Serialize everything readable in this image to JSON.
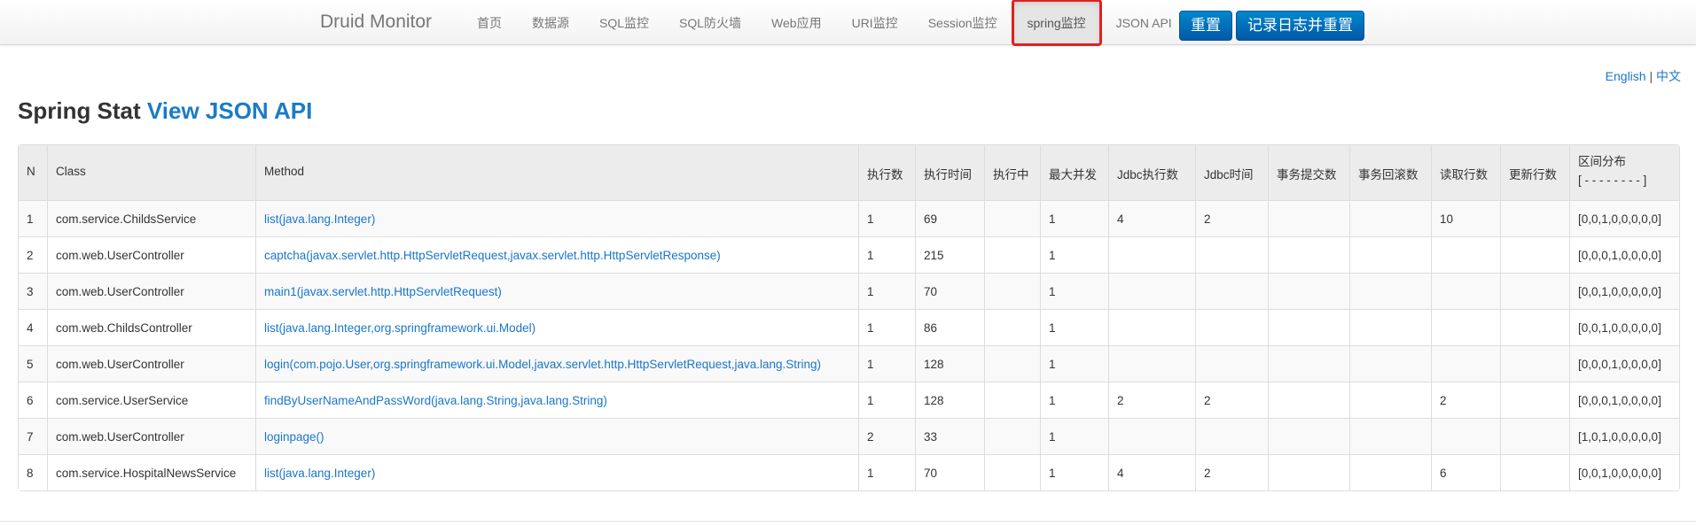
{
  "brand": "Druid Monitor",
  "nav": {
    "items": [
      "首页",
      "数据源",
      "SQL监控",
      "SQL防火墙",
      "Web应用",
      "URI监控",
      "Session监控",
      "spring监控",
      "JSON API"
    ],
    "active_index": 7,
    "reset_label": "重置",
    "log_reset_label": "记录日志并重置"
  },
  "lang": {
    "english": "English",
    "separator": "|",
    "chinese": "中文"
  },
  "title": {
    "text": "Spring Stat",
    "link": "View JSON API"
  },
  "table": {
    "columns": [
      "N",
      "Class",
      "Method",
      "执行数",
      "执行时间",
      "执行中",
      "最大并发",
      "Jdbc执行数",
      "Jdbc时间",
      "事务提交数",
      "事务回滚数",
      "读取行数",
      "更新行数"
    ],
    "dist_header": {
      "line1": "区间分布",
      "line2": "[ - - - - - - - - ]"
    },
    "rows": [
      [
        "1",
        "com.service.ChildsService",
        "list(java.lang.Integer)",
        "1",
        "69",
        "",
        "1",
        "4",
        "2",
        "",
        "",
        "10",
        "",
        "[0,0,1,0,0,0,0,0]"
      ],
      [
        "2",
        "com.web.UserController",
        "captcha(javax.servlet.http.HttpServletRequest,javax.servlet.http.HttpServletResponse)",
        "1",
        "215",
        "",
        "1",
        "",
        "",
        "",
        "",
        "",
        "",
        "[0,0,0,1,0,0,0,0]"
      ],
      [
        "3",
        "com.web.UserController",
        "main1(javax.servlet.http.HttpServletRequest)",
        "1",
        "70",
        "",
        "1",
        "",
        "",
        "",
        "",
        "",
        "",
        "[0,0,1,0,0,0,0,0]"
      ],
      [
        "4",
        "com.web.ChildsController",
        "list(java.lang.Integer,org.springframework.ui.Model)",
        "1",
        "86",
        "",
        "1",
        "",
        "",
        "",
        "",
        "",
        "",
        "[0,0,1,0,0,0,0,0]"
      ],
      [
        "5",
        "com.web.UserController",
        "login(com.pojo.User,org.springframework.ui.Model,javax.servlet.http.HttpServletRequest,java.lang.String)",
        "1",
        "128",
        "",
        "1",
        "",
        "",
        "",
        "",
        "",
        "",
        "[0,0,0,1,0,0,0,0]"
      ],
      [
        "6",
        "com.service.UserService",
        "findByUserNameAndPassWord(java.lang.String,java.lang.String)",
        "1",
        "128",
        "",
        "1",
        "2",
        "2",
        "",
        "",
        "2",
        "",
        "[0,0,0,1,0,0,0,0]"
      ],
      [
        "7",
        "com.web.UserController",
        "loginpage()",
        "2",
        "33",
        "",
        "1",
        "",
        "",
        "",
        "",
        "",
        "",
        "[1,0,1,0,0,0,0,0]"
      ],
      [
        "8",
        "com.service.HospitalNewsService",
        "list(java.lang.Integer)",
        "1",
        "70",
        "",
        "1",
        "4",
        "2",
        "",
        "",
        "6",
        "",
        "[0,0,1,0,0,0,0,0]"
      ]
    ]
  }
}
